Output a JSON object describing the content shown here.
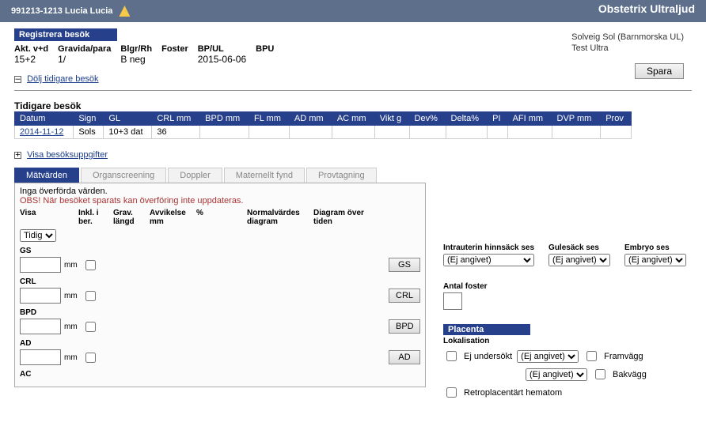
{
  "topbar": {
    "patient": "991213-1213 Lucia Lucia",
    "app_title": "Obstetrix Ultraljud"
  },
  "user": {
    "name": "Solveig Sol (Barnmorska UL)",
    "clinic": "Test Ultra"
  },
  "save_label": "Spara",
  "register": {
    "heading": "Registrera besök",
    "cols": {
      "akt": "Akt. v+d",
      "gravida": "Gravida/para",
      "blgr": "Blgr/Rh",
      "foster": "Foster",
      "bpul": "BP/UL",
      "bpu": "BPU"
    },
    "vals": {
      "akt": "15+2",
      "gravida": "1/",
      "blgr": "B neg",
      "foster": "",
      "bpul": "2015-06-06",
      "bpu": ""
    }
  },
  "toggle_prev": "Dölj tidigare besök",
  "toggle_show_visit": "Visa besöksuppgifter",
  "prev": {
    "title": "Tidigare besök",
    "hdr": {
      "datum": "Datum",
      "sign": "Sign",
      "gl": "GL",
      "crl": "CRL mm",
      "bpd": "BPD mm",
      "fl": "FL mm",
      "ad": "AD mm",
      "ac": "AC mm",
      "vikt": "Vikt g",
      "dev": "Dev%",
      "delta": "Delta%",
      "pi": "PI",
      "afi": "AFI mm",
      "dvp": "DVP mm",
      "prov": "Prov"
    },
    "row": {
      "datum": "2014-11-12",
      "sign": "Sols",
      "gl": "10+3 dat",
      "crl": "36"
    }
  },
  "tabs": {
    "matvarden": "Mätvärden",
    "organ": "Organscreening",
    "doppler": "Doppler",
    "maternellt": "Maternellt fynd",
    "prov": "Provtagning"
  },
  "tabinfo": {
    "line1": "Inga överförda värden.",
    "line2": "OBS! När besöket sparats kan överföring inte uppdateras."
  },
  "mhdr": {
    "visa": "Visa",
    "inkl": "Inkl. i ber.",
    "grav": "Grav. längd",
    "avv": "Avvikelse mm",
    "pct": "%",
    "norm": "Normalvärdes diagram",
    "diag": "Diagram över tiden"
  },
  "tidig": "Tidig",
  "meas": {
    "gs": {
      "lbl": "GS",
      "btn": "GS"
    },
    "crl": {
      "lbl": "CRL",
      "btn": "CRL"
    },
    "bpd": {
      "lbl": "BPD",
      "btn": "BPD"
    },
    "ad": {
      "lbl": "AD",
      "btn": "AD"
    },
    "ac": {
      "lbl": "AC"
    }
  },
  "unit": "mm",
  "rp": {
    "intra": "Intrauterin hinnsäck ses",
    "gule": "Gulesäck ses",
    "embryo": "Embryo ses",
    "ej": "(Ej angivet)",
    "antal": "Antal foster",
    "placenta": "Placenta",
    "lok": "Lokalisation",
    "ej_und": "Ej undersökt",
    "fram": "Framvägg",
    "bak": "Bakvägg",
    "retro": "Retroplacentärt hematom"
  }
}
